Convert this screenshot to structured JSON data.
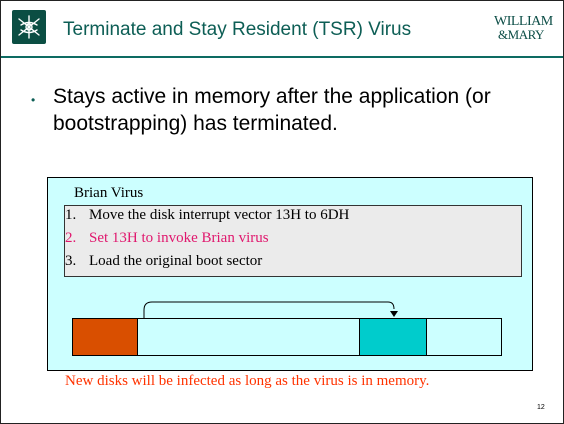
{
  "header": {
    "title": "Terminate and Stay Resident (TSR) Virus",
    "logo_right": {
      "line1": "WILLIAM",
      "line2": "&MARY"
    },
    "logo_left_icon": "cypher-crest-icon"
  },
  "body": {
    "bullet": "Stays active in memory after the application (or bootstrapping) has terminated."
  },
  "diagram": {
    "title": "Brian Virus",
    "steps": [
      {
        "num": "1.",
        "text": "Move the disk interrupt vector 13H to 6DH",
        "color": "#000000"
      },
      {
        "num": "2.",
        "text": "Set 13H to invoke Brian virus",
        "color": "#e0186e"
      },
      {
        "num": "3.",
        "text": "Load the original boot sector",
        "color": "#000000"
      }
    ],
    "colors": {
      "background": "#ccffff",
      "boot_segment": "#d94f00",
      "virus_segment": "#00cccc"
    }
  },
  "caption": "New disks will be infected as long as the virus is in memory.",
  "page_number": "12"
}
